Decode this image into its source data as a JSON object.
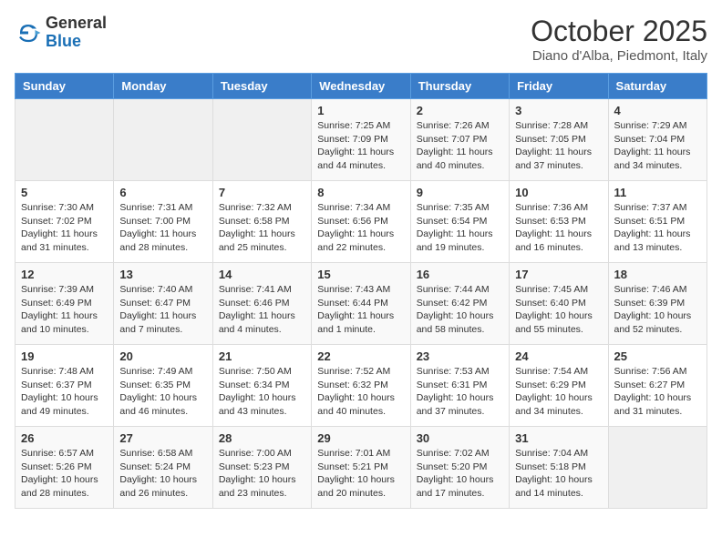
{
  "logo": {
    "general": "General",
    "blue": "Blue"
  },
  "header": {
    "month": "October 2025",
    "location": "Diano d'Alba, Piedmont, Italy"
  },
  "days_of_week": [
    "Sunday",
    "Monday",
    "Tuesday",
    "Wednesday",
    "Thursday",
    "Friday",
    "Saturday"
  ],
  "weeks": [
    [
      {
        "day": "",
        "info": ""
      },
      {
        "day": "",
        "info": ""
      },
      {
        "day": "",
        "info": ""
      },
      {
        "day": "1",
        "info": "Sunrise: 7:25 AM\nSunset: 7:09 PM\nDaylight: 11 hours\nand 44 minutes."
      },
      {
        "day": "2",
        "info": "Sunrise: 7:26 AM\nSunset: 7:07 PM\nDaylight: 11 hours\nand 40 minutes."
      },
      {
        "day": "3",
        "info": "Sunrise: 7:28 AM\nSunset: 7:05 PM\nDaylight: 11 hours\nand 37 minutes."
      },
      {
        "day": "4",
        "info": "Sunrise: 7:29 AM\nSunset: 7:04 PM\nDaylight: 11 hours\nand 34 minutes."
      }
    ],
    [
      {
        "day": "5",
        "info": "Sunrise: 7:30 AM\nSunset: 7:02 PM\nDaylight: 11 hours\nand 31 minutes."
      },
      {
        "day": "6",
        "info": "Sunrise: 7:31 AM\nSunset: 7:00 PM\nDaylight: 11 hours\nand 28 minutes."
      },
      {
        "day": "7",
        "info": "Sunrise: 7:32 AM\nSunset: 6:58 PM\nDaylight: 11 hours\nand 25 minutes."
      },
      {
        "day": "8",
        "info": "Sunrise: 7:34 AM\nSunset: 6:56 PM\nDaylight: 11 hours\nand 22 minutes."
      },
      {
        "day": "9",
        "info": "Sunrise: 7:35 AM\nSunset: 6:54 PM\nDaylight: 11 hours\nand 19 minutes."
      },
      {
        "day": "10",
        "info": "Sunrise: 7:36 AM\nSunset: 6:53 PM\nDaylight: 11 hours\nand 16 minutes."
      },
      {
        "day": "11",
        "info": "Sunrise: 7:37 AM\nSunset: 6:51 PM\nDaylight: 11 hours\nand 13 minutes."
      }
    ],
    [
      {
        "day": "12",
        "info": "Sunrise: 7:39 AM\nSunset: 6:49 PM\nDaylight: 11 hours\nand 10 minutes."
      },
      {
        "day": "13",
        "info": "Sunrise: 7:40 AM\nSunset: 6:47 PM\nDaylight: 11 hours\nand 7 minutes."
      },
      {
        "day": "14",
        "info": "Sunrise: 7:41 AM\nSunset: 6:46 PM\nDaylight: 11 hours\nand 4 minutes."
      },
      {
        "day": "15",
        "info": "Sunrise: 7:43 AM\nSunset: 6:44 PM\nDaylight: 11 hours\nand 1 minute."
      },
      {
        "day": "16",
        "info": "Sunrise: 7:44 AM\nSunset: 6:42 PM\nDaylight: 10 hours\nand 58 minutes."
      },
      {
        "day": "17",
        "info": "Sunrise: 7:45 AM\nSunset: 6:40 PM\nDaylight: 10 hours\nand 55 minutes."
      },
      {
        "day": "18",
        "info": "Sunrise: 7:46 AM\nSunset: 6:39 PM\nDaylight: 10 hours\nand 52 minutes."
      }
    ],
    [
      {
        "day": "19",
        "info": "Sunrise: 7:48 AM\nSunset: 6:37 PM\nDaylight: 10 hours\nand 49 minutes."
      },
      {
        "day": "20",
        "info": "Sunrise: 7:49 AM\nSunset: 6:35 PM\nDaylight: 10 hours\nand 46 minutes."
      },
      {
        "day": "21",
        "info": "Sunrise: 7:50 AM\nSunset: 6:34 PM\nDaylight: 10 hours\nand 43 minutes."
      },
      {
        "day": "22",
        "info": "Sunrise: 7:52 AM\nSunset: 6:32 PM\nDaylight: 10 hours\nand 40 minutes."
      },
      {
        "day": "23",
        "info": "Sunrise: 7:53 AM\nSunset: 6:31 PM\nDaylight: 10 hours\nand 37 minutes."
      },
      {
        "day": "24",
        "info": "Sunrise: 7:54 AM\nSunset: 6:29 PM\nDaylight: 10 hours\nand 34 minutes."
      },
      {
        "day": "25",
        "info": "Sunrise: 7:56 AM\nSunset: 6:27 PM\nDaylight: 10 hours\nand 31 minutes."
      }
    ],
    [
      {
        "day": "26",
        "info": "Sunrise: 6:57 AM\nSunset: 5:26 PM\nDaylight: 10 hours\nand 28 minutes."
      },
      {
        "day": "27",
        "info": "Sunrise: 6:58 AM\nSunset: 5:24 PM\nDaylight: 10 hours\nand 26 minutes."
      },
      {
        "day": "28",
        "info": "Sunrise: 7:00 AM\nSunset: 5:23 PM\nDaylight: 10 hours\nand 23 minutes."
      },
      {
        "day": "29",
        "info": "Sunrise: 7:01 AM\nSunset: 5:21 PM\nDaylight: 10 hours\nand 20 minutes."
      },
      {
        "day": "30",
        "info": "Sunrise: 7:02 AM\nSunset: 5:20 PM\nDaylight: 10 hours\nand 17 minutes."
      },
      {
        "day": "31",
        "info": "Sunrise: 7:04 AM\nSunset: 5:18 PM\nDaylight: 10 hours\nand 14 minutes."
      },
      {
        "day": "",
        "info": ""
      }
    ]
  ]
}
